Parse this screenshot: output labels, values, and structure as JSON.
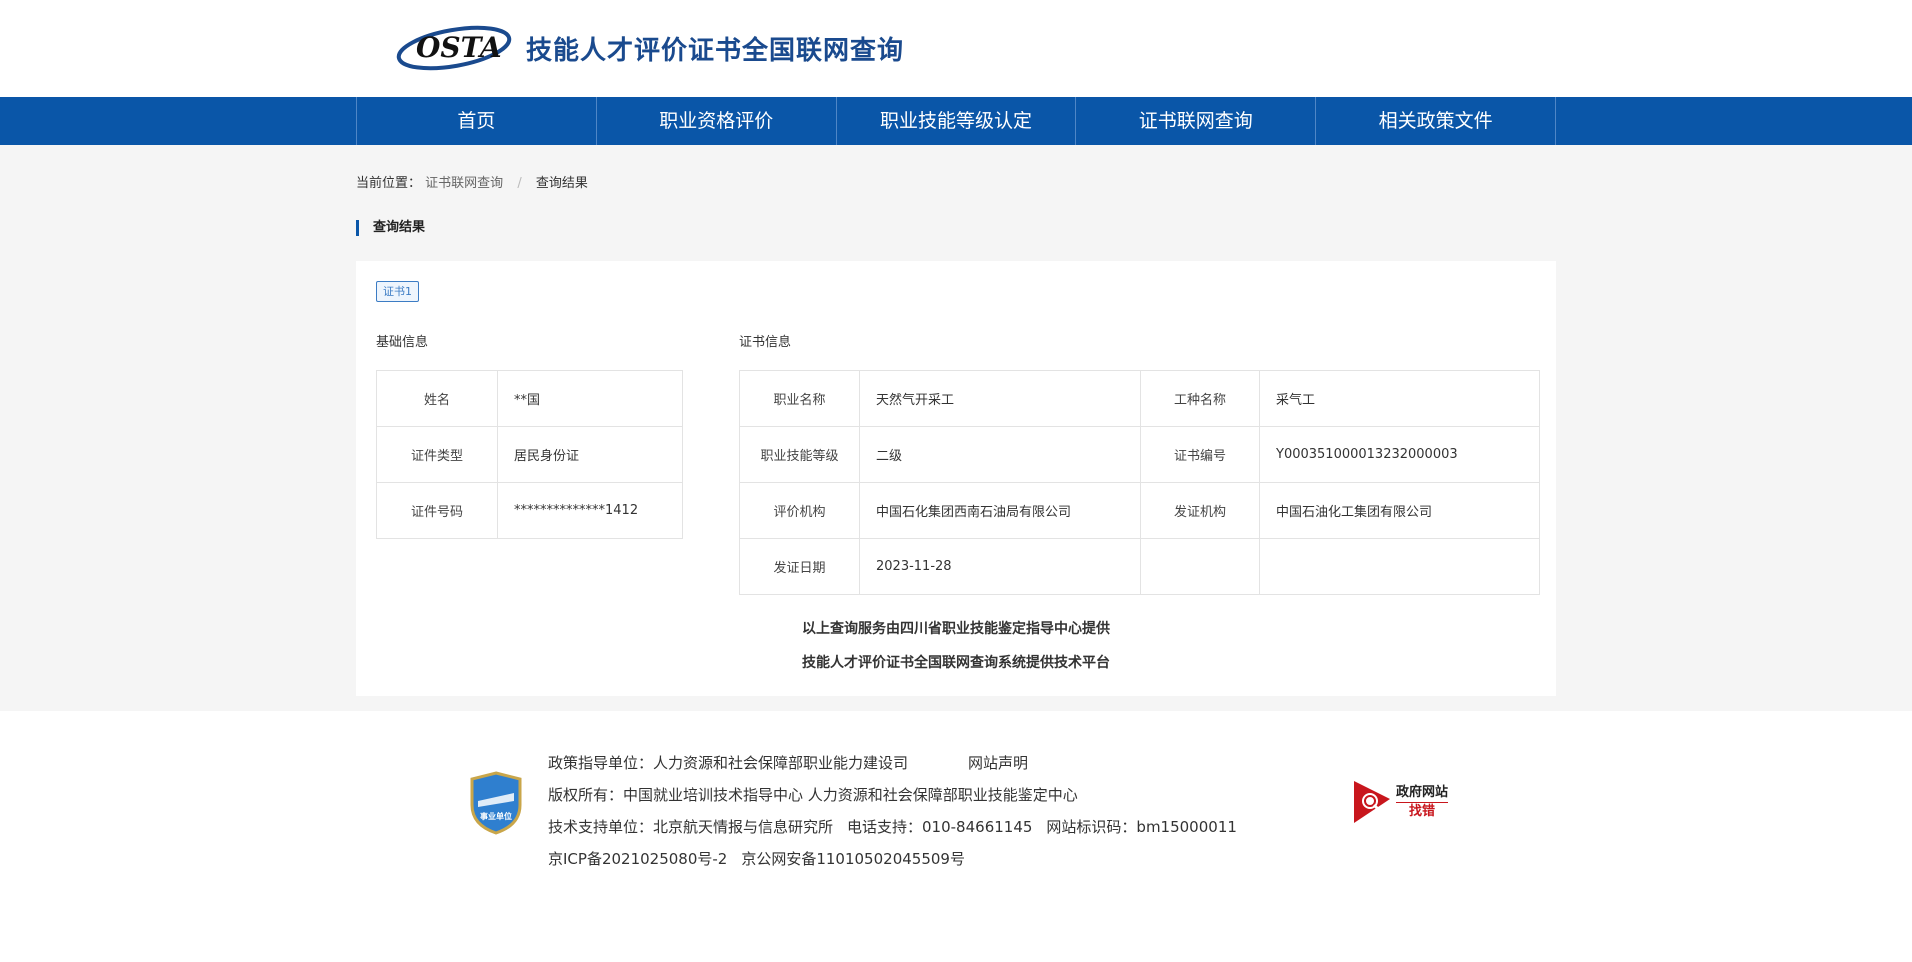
{
  "header": {
    "logo_text": "OSTA",
    "title": "技能人才评价证书全国联网查询"
  },
  "nav": {
    "items": [
      {
        "label": "首页"
      },
      {
        "label": "职业资格评价"
      },
      {
        "label": "职业技能等级认定"
      },
      {
        "label": "证书联网查询"
      },
      {
        "label": "相关政策文件"
      }
    ]
  },
  "breadcrumb": {
    "prefix": "当前位置：",
    "parent": "证书联网查询",
    "separator": "/",
    "current": "查询结果"
  },
  "section_title": "查询结果",
  "certificate": {
    "tab_label": "证书1",
    "basic_label": "基础信息",
    "basic": [
      {
        "key": "姓名",
        "value": "**国"
      },
      {
        "key": "证件类型",
        "value": "居民身份证"
      },
      {
        "key": "证件号码",
        "value": "**************1412"
      }
    ],
    "cert_label": "证书信息",
    "cert_rows": [
      {
        "k1": "职业名称",
        "v1": "天然气开采工",
        "k2": "工种名称",
        "v2": "采气工"
      },
      {
        "k1": "职业技能等级",
        "v1": "二级",
        "k2": "证书编号",
        "v2": "Y000351000013232000003"
      },
      {
        "k1": "评价机构",
        "v1": "中国石化集团西南石油局有限公司",
        "k2": "发证机构",
        "v2": "中国石油化工集团有限公司"
      },
      {
        "k1": "发证日期",
        "v1": "2023-11-28",
        "k2": "",
        "v2": ""
      }
    ],
    "notice_1": "以上查询服务由四川省职业技能鉴定指导中心提供",
    "notice_2": "技能人才评价证书全国联网查询系统提供技术平台"
  },
  "footer": {
    "line1_a": "政策指导单位：人力资源和社会保障部职业能力建设司",
    "line1_b": "网站声明",
    "line2": "版权所有：中国就业培训技术指导中心   人力资源和社会保障部职业技能鉴定中心",
    "line3_a": "技术支持单位：北京航天情报与信息研究所",
    "line3_b": "电话支持：010-84661145",
    "line3_c": "网站标识码：bm15000011",
    "line4_a": "京ICP备2021025080号-2",
    "line4_b": "京公网安备11010502045509号",
    "badge_text": "事业单位",
    "gov_text_1": "政府网站",
    "gov_text_2": "找错"
  },
  "colors": {
    "nav_blue": "#0a56a8",
    "title_blue": "#1a4a8e",
    "gov_red": "#c8161d"
  }
}
